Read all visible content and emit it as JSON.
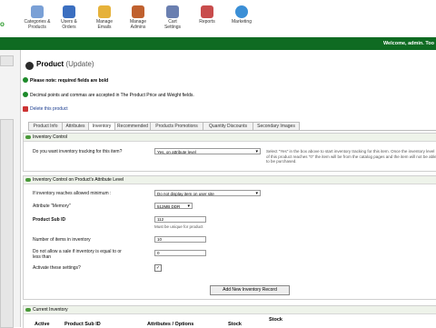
{
  "logo_fragment": "o",
  "toolbar": {
    "items": [
      {
        "label_line1": "Categories &",
        "label_line2": "Products",
        "icon": "boxes-icon",
        "color": "#7aa0d6"
      },
      {
        "label_line1": "Users &",
        "label_line2": "Orders",
        "icon": "users-icon",
        "color": "#3b6fc0"
      },
      {
        "label_line1": "Manage",
        "label_line2": "Emails",
        "icon": "email-icon",
        "color": "#e6b23a"
      },
      {
        "label_line1": "Manage",
        "label_line2": "Admins",
        "icon": "admin-icon",
        "color": "#c0612f"
      },
      {
        "label_line1": "Cart",
        "label_line2": "Settings",
        "icon": "cart-icon",
        "color": "#6a7fb0"
      },
      {
        "label_line1": "Reports",
        "label_line2": "",
        "icon": "reports-icon",
        "color": "#c84c4c"
      },
      {
        "label_line1": "Marketing",
        "label_line2": "",
        "icon": "globe-icon",
        "color": "#3b8fd6"
      }
    ]
  },
  "header": {
    "welcome": "Welcome, admin. Too"
  },
  "page": {
    "title": "Product",
    "subtitle": "(Update)",
    "note_required": "Please note: required fields are bold",
    "note_decimal": "Decimal points and commas are accepted in The Product Price and Weight fields.",
    "delete_label": "Delete this product"
  },
  "tabs": [
    "Product Info",
    "Attributes",
    "Inventory",
    "Recommended",
    "Products Promotions",
    "Quantity Discounts",
    "Secondary Images"
  ],
  "active_tab": "Inventory",
  "inventory_control": {
    "heading": "Inventory Control",
    "question": "Do you want inventory tracking for this item?",
    "select_value": "Yes, on attribute level",
    "help": "Select \"Yes\" in the box above to start inventory tracking for this item. Once the inventory level of this product reaches \"0\" the item will be",
    "help2": "from the catalog pages and the item will not be able to be purchased."
  },
  "attr_level": {
    "heading": "Inventory Control on Product's Attribute Level",
    "if_min_label": "If inventory reaches allowed minimum :",
    "if_min_value": "Do not display item on user site",
    "attribute_label": "Attribute \"Memory\"",
    "attribute_value": "512MB DDR",
    "sub_id_label": "Product Sub ID",
    "sub_id_value": "112",
    "sub_id_help": "Must be unique for product",
    "num_items_label": "Number of items in inventory",
    "num_items_value": "10",
    "no_sale_label": "Do not allow a sale if inventory is equal to or less than",
    "no_sale_value": "0",
    "activate_label": "Activate these settings?",
    "activate_checked": "✓",
    "add_button": "Add New Inventory Record"
  },
  "current_inventory": {
    "heading": "Current Inventory",
    "columns": [
      "Active",
      "Product Sub ID",
      "Attributes / Options",
      "Stock",
      "Stock"
    ]
  }
}
